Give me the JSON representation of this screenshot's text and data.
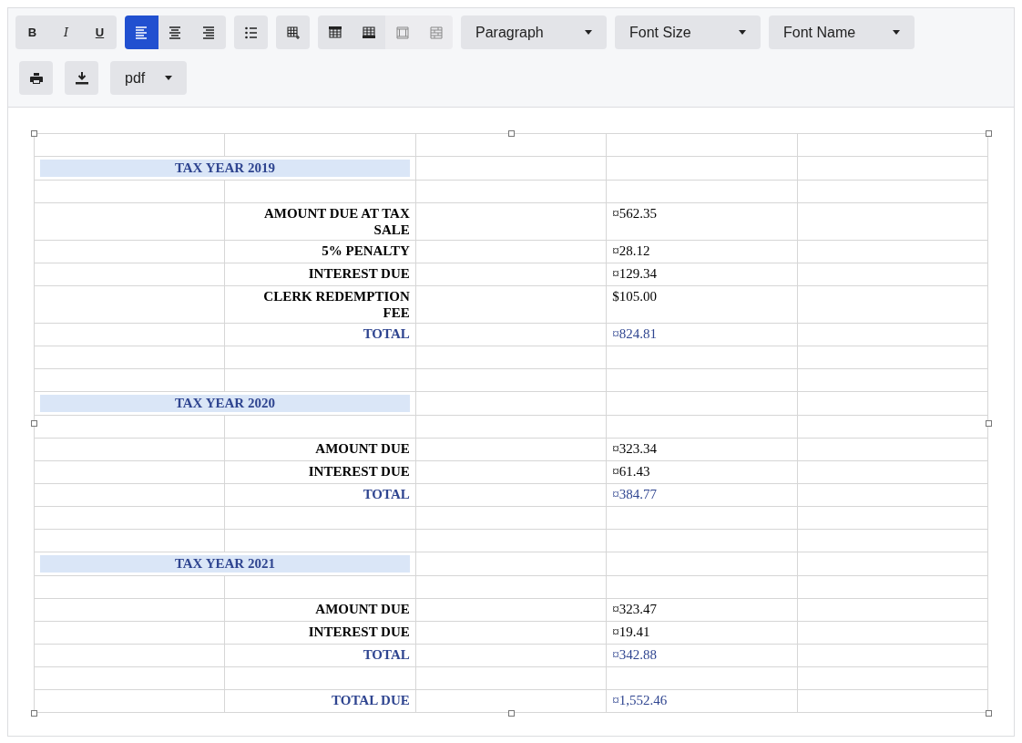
{
  "toolbar": {
    "rows": [
      {
        "groups": [
          {
            "kind": "button-group",
            "buttons": [
              {
                "kind": "bold",
                "label": "B"
              },
              {
                "kind": "italic",
                "label": "I"
              },
              {
                "kind": "underline",
                "label": "U"
              }
            ]
          },
          {
            "kind": "button-group",
            "buttons": [
              {
                "kind": "align-left",
                "selected": true
              },
              {
                "kind": "align-center",
                "selected": false
              },
              {
                "kind": "align-right",
                "selected": false
              }
            ]
          },
          {
            "kind": "button-group",
            "buttons": [
              {
                "kind": "bullet-list"
              }
            ]
          },
          {
            "kind": "button-group",
            "buttons": [
              {
                "kind": "insert-table"
              }
            ]
          },
          {
            "kind": "button-group",
            "buttons": [
              {
                "kind": "header-row",
                "disabled": false
              },
              {
                "kind": "footer-row",
                "disabled": false
              },
              {
                "kind": "banded-cols",
                "disabled": true
              },
              {
                "kind": "banded-rows",
                "disabled": true
              }
            ]
          },
          {
            "kind": "dropdown",
            "label": "Paragraph"
          },
          {
            "kind": "dropdown",
            "label": "Font Size"
          },
          {
            "kind": "dropdown",
            "label": "Font Name"
          }
        ]
      },
      {
        "groups": [
          {
            "kind": "button-group",
            "buttons": [
              {
                "kind": "print"
              }
            ]
          },
          {
            "kind": "button-group",
            "buttons": [
              {
                "kind": "download"
              }
            ]
          },
          {
            "kind": "export-dropdown",
            "label": "pdf"
          }
        ]
      }
    ]
  },
  "table": {
    "rows": [
      {
        "kind": "blank"
      },
      {
        "kind": "header",
        "label": "TAX YEAR 2019"
      },
      {
        "kind": "blank"
      },
      {
        "kind": "item",
        "label": "AMOUNT DUE AT TAX SALE",
        "value": "¤562.35"
      },
      {
        "kind": "item",
        "label": "5% PENALTY",
        "value": "¤28.12"
      },
      {
        "kind": "item",
        "label": "INTEREST DUE",
        "value": "¤129.34"
      },
      {
        "kind": "item",
        "label": "CLERK REDEMPTION FEE",
        "value": "$105.00"
      },
      {
        "kind": "total",
        "label": "TOTAL",
        "value": "¤824.81"
      },
      {
        "kind": "blank"
      },
      {
        "kind": "blank"
      },
      {
        "kind": "header",
        "label": "TAX YEAR 2020"
      },
      {
        "kind": "blank"
      },
      {
        "kind": "item",
        "label": "AMOUNT DUE",
        "value": "¤323.34"
      },
      {
        "kind": "item",
        "label": "INTEREST DUE",
        "value": "¤61.43"
      },
      {
        "kind": "total",
        "label": "TOTAL",
        "value": "¤384.77"
      },
      {
        "kind": "blank"
      },
      {
        "kind": "blank"
      },
      {
        "kind": "header",
        "label": "TAX YEAR 2021"
      },
      {
        "kind": "blank"
      },
      {
        "kind": "item",
        "label": "AMOUNT DUE",
        "value": "¤323.47"
      },
      {
        "kind": "item",
        "label": "INTEREST DUE",
        "value": "¤19.41"
      },
      {
        "kind": "total",
        "label": "TOTAL",
        "value": "¤342.88"
      },
      {
        "kind": "blank"
      },
      {
        "kind": "total",
        "label": "TOTAL DUE",
        "value": "¤1,552.46"
      }
    ]
  }
}
